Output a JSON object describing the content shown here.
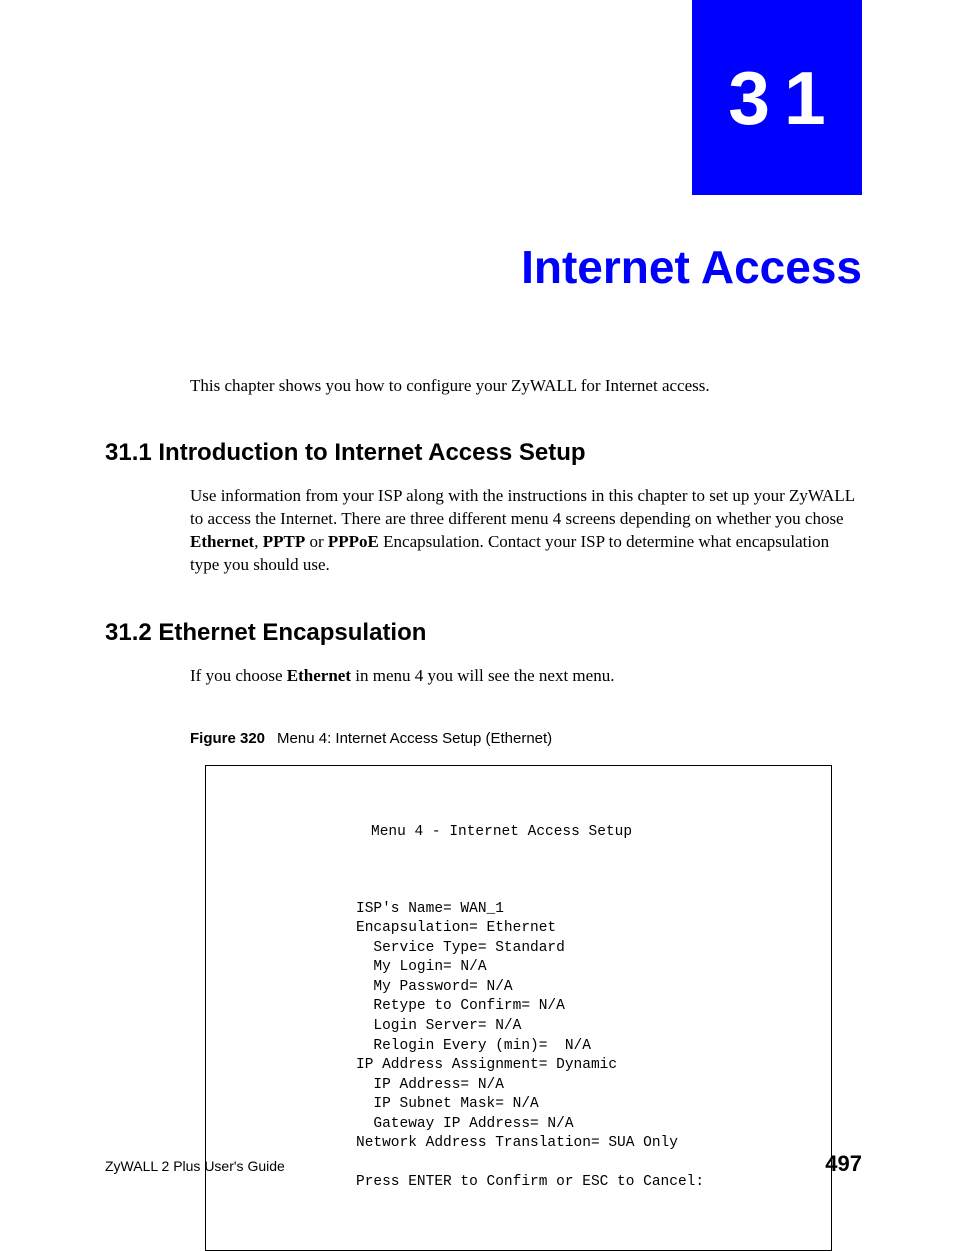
{
  "chapter": {
    "number": "31",
    "title": "Internet Access",
    "intro": "This chapter shows you how to configure your ZyWALL for Internet access."
  },
  "sections": {
    "s1": {
      "heading": "31.1  Introduction to Internet Access Setup",
      "body_pre": "Use information from your ISP along with the instructions in this chapter to set up your ZyWALL to access the Internet. There are three different menu 4 screens depending on whether you chose ",
      "bold1": "Ethernet",
      "sep1": ", ",
      "bold2": "PPTP",
      "sep2": " or ",
      "bold3": "PPPoE",
      "body_post": " Encapsulation. Contact your ISP to determine what encapsulation type you should use."
    },
    "s2": {
      "heading": "31.2  Ethernet Encapsulation",
      "body_pre": "If you choose ",
      "bold1": "Ethernet",
      "body_post": " in menu 4 you will see the next menu."
    }
  },
  "figure": {
    "label": "Figure 320",
    "caption": "Menu 4: Internet Access Setup (Ethernet)"
  },
  "menu": {
    "header": "Menu 4 - Internet Access Setup",
    "lines": "ISP's Name= WAN_1\nEncapsulation= Ethernet\n  Service Type= Standard\n  My Login= N/A\n  My Password= N/A\n  Retype to Confirm= N/A\n  Login Server= N/A\n  Relogin Every (min)=  N/A\nIP Address Assignment= Dynamic\n  IP Address= N/A\n  IP Subnet Mask= N/A\n  Gateway IP Address= N/A\nNetwork Address Translation= SUA Only\n\nPress ENTER to Confirm or ESC to Cancel:"
  },
  "footer": {
    "guide": "ZyWALL 2 Plus User's Guide",
    "page": "497"
  }
}
